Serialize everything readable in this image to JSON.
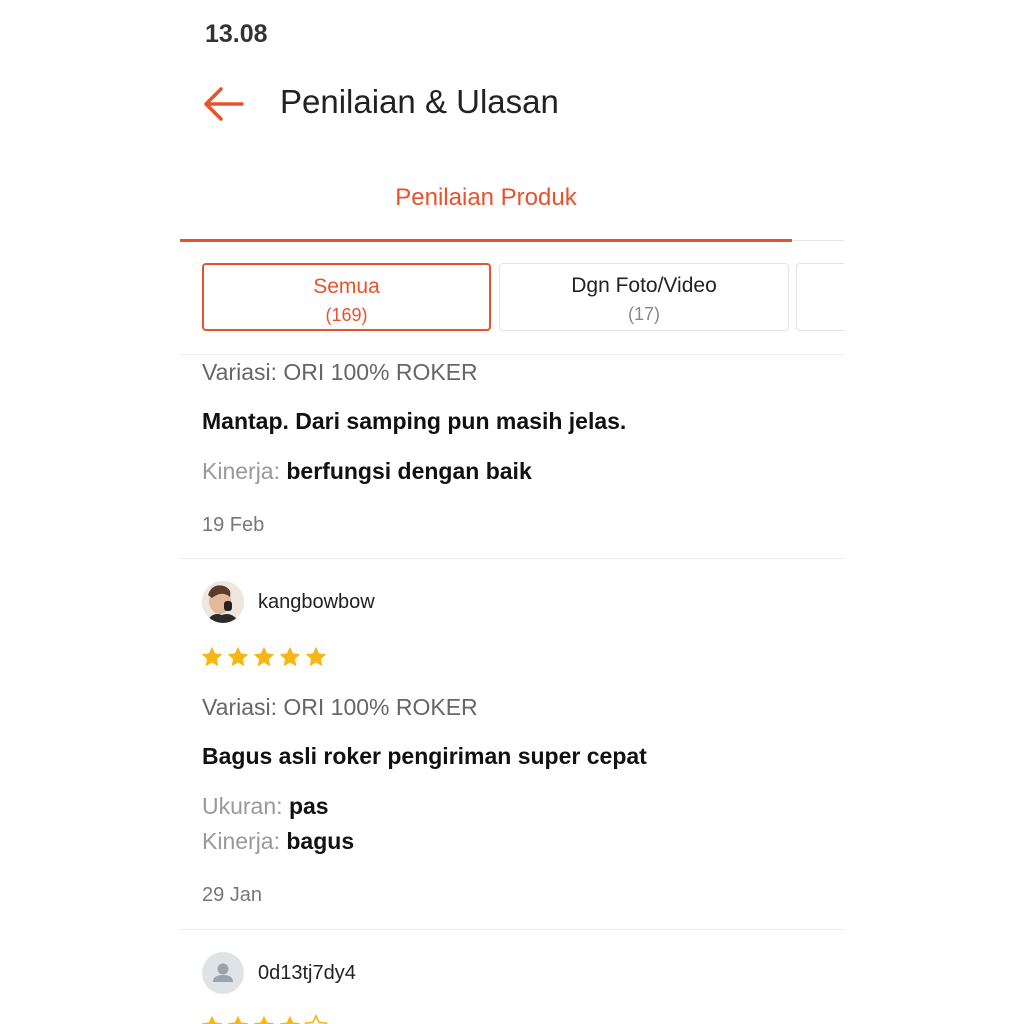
{
  "status_bar": {
    "time": "13.08"
  },
  "header": {
    "title": "Penilaian & Ulasan",
    "back_icon": "arrow-left-icon",
    "accent": "#e5532d"
  },
  "tabs": [
    {
      "label": "Penilaian Produk",
      "active": true
    }
  ],
  "filters": [
    {
      "label": "Semua",
      "count": "(169)",
      "selected": true
    },
    {
      "label": "Dgn Foto/Video",
      "count": "(17)",
      "selected": false
    }
  ],
  "reviews": [
    {
      "variant": "Variasi: ORI 100% ROKER",
      "comment": "Mantap. Dari samping pun masih jelas.",
      "attributes": [
        {
          "key": "Kinerja:",
          "value": "berfungsi dengan baik"
        }
      ],
      "date": "19 Feb"
    },
    {
      "username": "kangbowbow",
      "rating": 5,
      "variant": "Variasi: ORI 100% ROKER",
      "comment": "Bagus asli roker pengiriman super cepat",
      "attributes": [
        {
          "key": "Ukuran:",
          "value": "pas"
        },
        {
          "key": "Kinerja:",
          "value": "bagus"
        }
      ],
      "date": "29 Jan"
    },
    {
      "username": "0d13tj7dy4",
      "avatar_icon": "user-icon"
    }
  ],
  "colors": {
    "star": "#f6b716",
    "accent": "#e5532d"
  }
}
